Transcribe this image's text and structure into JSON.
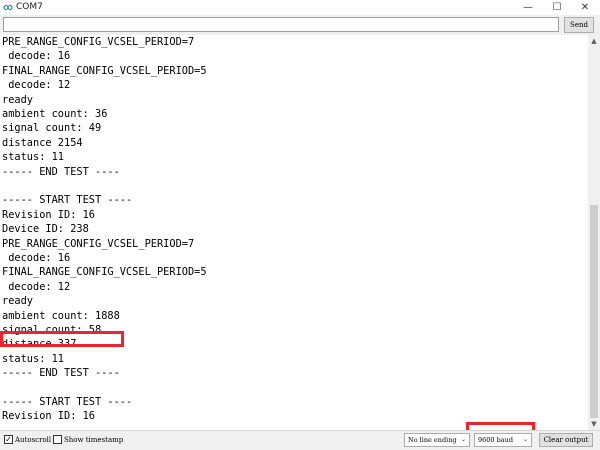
{
  "window": {
    "title": "COM7",
    "app_icon": "arduino-infinity-icon",
    "controls": {
      "minimize": "—",
      "maximize": "☐",
      "close": "✕"
    }
  },
  "send_bar": {
    "input_value": "",
    "send_label": "Send"
  },
  "serial_output": {
    "lines": [
      "PRE_RANGE_CONFIG_VCSEL_PERIOD=7",
      " decode: 16",
      "FINAL_RANGE_CONFIG_VCSEL_PERIOD=5",
      " decode: 12",
      "ready",
      "ambient count: 36",
      "signal count: 49",
      "distance 2154",
      "status: 11",
      "----- END TEST ----",
      "",
      "----- START TEST ----",
      "Revision ID: 16",
      "Device ID: 238",
      "PRE_RANGE_CONFIG_VCSEL_PERIOD=7",
      " decode: 16",
      "FINAL_RANGE_CONFIG_VCSEL_PERIOD=5",
      " decode: 12",
      "ready",
      "ambient count: 1888",
      "signal count: 58",
      "distance 337",
      "status: 11",
      "----- END TEST ----",
      "",
      "----- START TEST ----",
      "Revision ID: 16"
    ]
  },
  "bottom_bar": {
    "autoscroll_label": "Autoscroll",
    "autoscroll_checked": true,
    "timestamp_label": "Show timestamp",
    "timestamp_checked": false,
    "line_ending_selected": "No line ending",
    "baud_selected": "9600 baud",
    "clear_label": "Clear output"
  },
  "highlight_color": "#e8262d"
}
